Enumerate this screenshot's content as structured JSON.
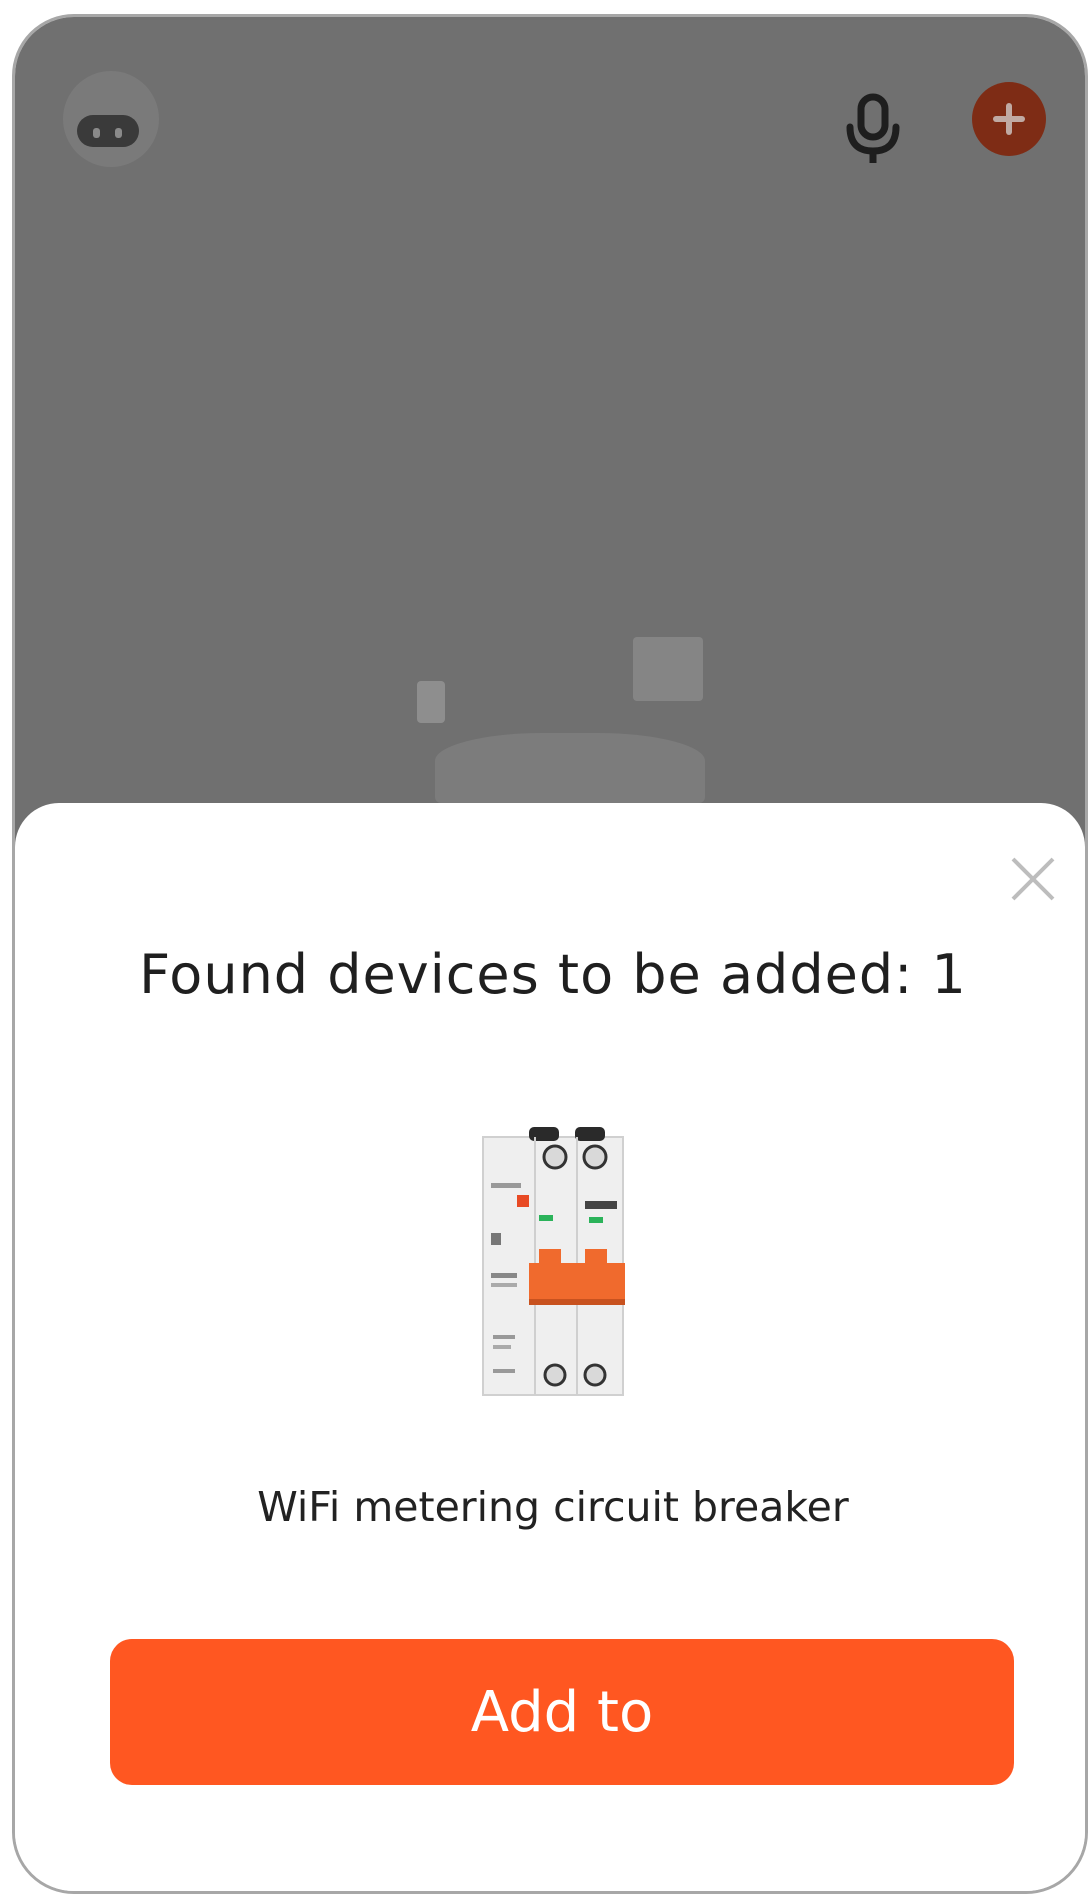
{
  "home": {
    "icons": {
      "avatar": "robot-avatar-icon",
      "mic": "microphone-icon",
      "add": "plus-circle-icon"
    }
  },
  "dialog": {
    "title": "Found devices to be added: 1",
    "close_icon": "close-icon",
    "device": {
      "name": "WiFi metering circuit breaker",
      "image": "circuit-breaker-image"
    },
    "add_button_label": "Add to"
  },
  "colors": {
    "accent": "#ff5721",
    "overlay": "#707070",
    "title_text": "#1f1f1f"
  }
}
